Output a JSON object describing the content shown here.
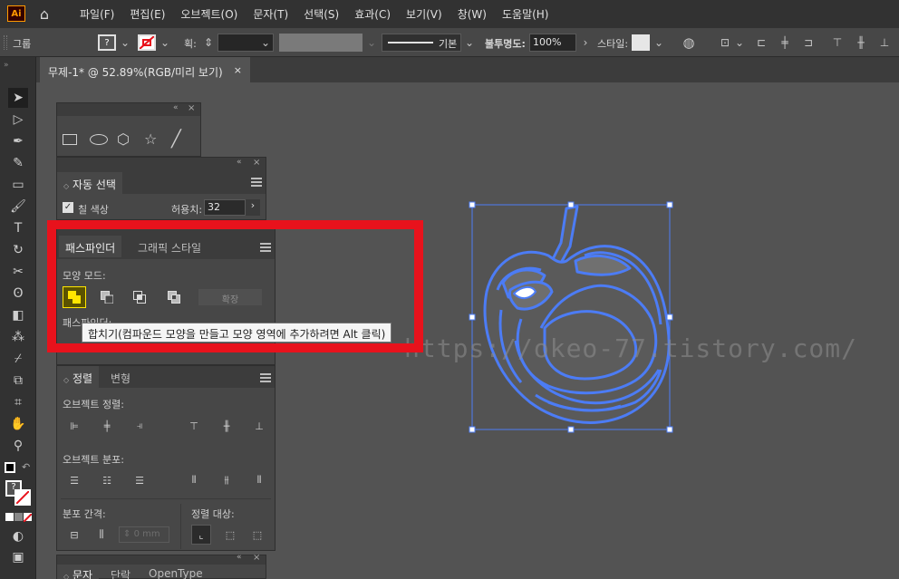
{
  "app": {
    "logo": "Ai"
  },
  "menu": [
    "파일(F)",
    "편집(E)",
    "오브젝트(O)",
    "문자(T)",
    "선택(S)",
    "효과(C)",
    "보기(V)",
    "창(W)",
    "도움말(H)"
  ],
  "controlbar": {
    "group_label": "그룹",
    "stroke_label": "획:",
    "stroke_style": "기본",
    "opacity_label": "불투명도:",
    "opacity_value": "100%",
    "style_label": "스타일:"
  },
  "document": {
    "tab_title": "무제-1* @ 52.89%(RGB/미리 보기)",
    "close": "×"
  },
  "auto_select_panel": {
    "title": "자동 선택",
    "fill_color_label": "칠 색상",
    "fill_color_checked": true,
    "tolerance_label": "허용치:",
    "tolerance_value": "32"
  },
  "pathfinder_panel": {
    "tabs": [
      "패스파인더",
      "그래픽 스타일"
    ],
    "shape_modes_label": "모양 모드:",
    "expand_label": "확장",
    "pathfinders_label": "패스파인더:",
    "tooltip": "합치기(컴파운드 모양을 만들고 모양 영역에 추가하려면 Alt 클릭)"
  },
  "align_panel": {
    "tabs": [
      "정렬",
      "변형"
    ],
    "align_objects_label": "오브젝트 정렬:",
    "distribute_objects_label": "오브젝트 분포:",
    "distribute_spacing_label": "분포 간격:",
    "spacing_value": "0 mm",
    "align_to_label": "정렬 대상:"
  },
  "type_panel": {
    "tabs": [
      "문자",
      "단락",
      "OpenType"
    ]
  },
  "watermark": "https://okeo-77.tistory.com/",
  "colors": {
    "highlight": "#e8121c",
    "selection": "#4c7cf5",
    "active_shape_mode": "#ffe600"
  }
}
